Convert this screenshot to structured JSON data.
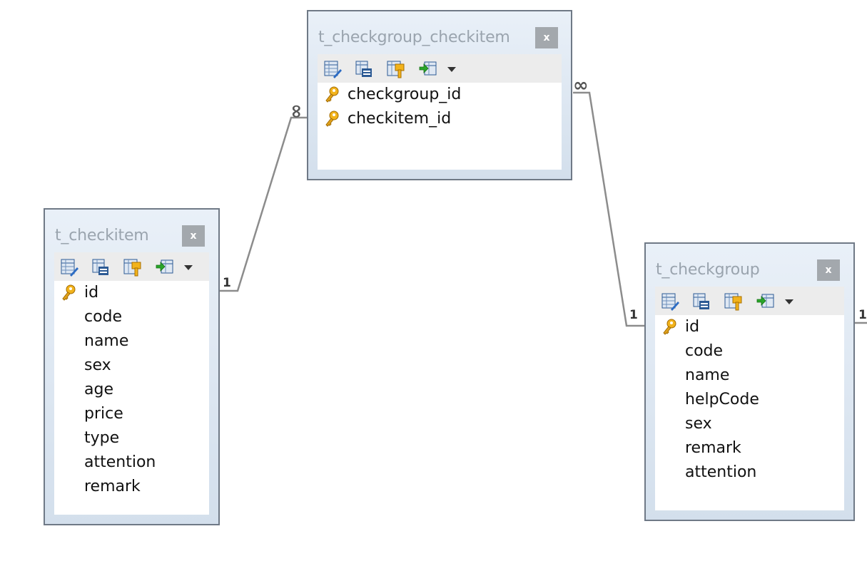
{
  "tables": {
    "checkgroup_checkitem": {
      "title": "t_checkgroup_checkitem",
      "close_label": "x",
      "fields": [
        {
          "name": "checkgroup_id",
          "key": true
        },
        {
          "name": "checkitem_id",
          "key": true
        }
      ]
    },
    "checkitem": {
      "title": "t_checkitem",
      "close_label": "x",
      "fields": [
        {
          "name": "id",
          "key": true
        },
        {
          "name": "code",
          "key": false
        },
        {
          "name": "name",
          "key": false
        },
        {
          "name": "sex",
          "key": false
        },
        {
          "name": "age",
          "key": false
        },
        {
          "name": "price",
          "key": false
        },
        {
          "name": "type",
          "key": false
        },
        {
          "name": "attention",
          "key": false
        },
        {
          "name": "remark",
          "key": false
        }
      ]
    },
    "checkgroup": {
      "title": "t_checkgroup",
      "close_label": "x",
      "fields": [
        {
          "name": "id",
          "key": true
        },
        {
          "name": "code",
          "key": false
        },
        {
          "name": "name",
          "key": false
        },
        {
          "name": "helpCode",
          "key": false
        },
        {
          "name": "sex",
          "key": false
        },
        {
          "name": "remark",
          "key": false
        },
        {
          "name": "attention",
          "key": false
        }
      ]
    }
  },
  "relations": [
    {
      "from": "checkitem",
      "to": "checkgroup_checkitem",
      "from_card": "1",
      "to_card": "∞"
    },
    {
      "from": "checkgroup",
      "to": "checkgroup_checkitem",
      "from_card": "1",
      "to_card": "∞"
    }
  ],
  "edge_label": "1",
  "toolbar_icons": [
    "design-table-icon",
    "view-table-icon",
    "key-table-icon",
    "import-icon",
    "chevron-down-icon"
  ],
  "colors": {
    "border": "#6f7986",
    "title": "#9aa4ae",
    "line": "#8c8c8c",
    "key": "#e0a21c"
  }
}
